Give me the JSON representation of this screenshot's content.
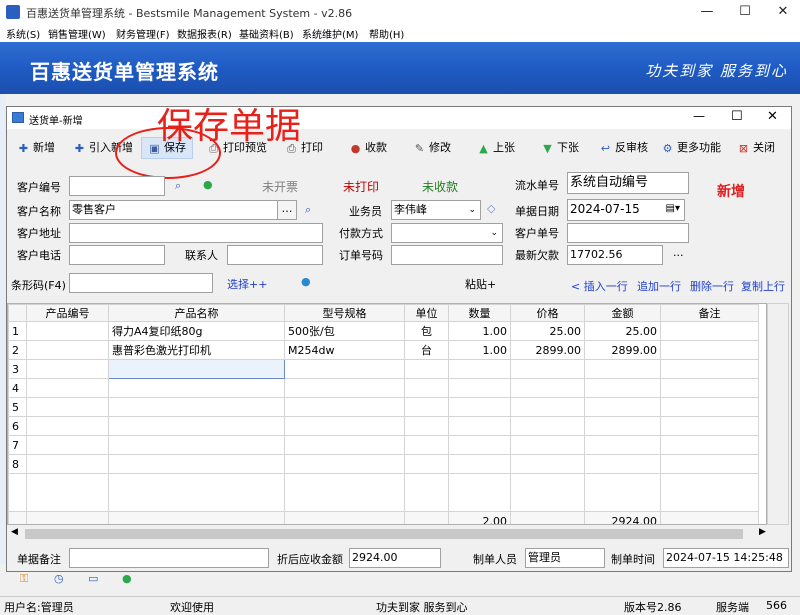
{
  "app": {
    "title": "百惠送货单管理系统 - Bestsmile Management System - v2.86",
    "menu": [
      "系统(S)",
      "销售管理(W)",
      "财务管理(F)",
      "数据报表(R)",
      "基础资料(B)",
      "系统维护(M)",
      "帮助(H)"
    ],
    "banner_title": "百惠送货单管理系统",
    "banner_slogan": "功夫到家  服务到心"
  },
  "window": {
    "title": "送货单-新增",
    "annotation": "保存单据"
  },
  "toolbar": {
    "new": "新增",
    "import_new": "引入新增",
    "save": "保存",
    "print_preview": "打印预览",
    "print": "打印",
    "receive": "收款",
    "edit": "修改",
    "prev": "上张",
    "next": "下张",
    "unaudit": "反审核",
    "more": "更多功能",
    "close": "关闭"
  },
  "form": {
    "customer_code_label": "客户编号",
    "customer_code": "",
    "customer_name_label": "客户名称",
    "customer_name": "零售客户",
    "customer_addr_label": "客户地址",
    "customer_addr": "",
    "customer_phone_label": "客户电话",
    "customer_phone": "",
    "contact_label": "联系人",
    "contact": "",
    "status_invoice": "未开票",
    "status_print": "未打印",
    "status_payment": "未收款",
    "salesman_label": "业务员",
    "salesman": "李伟峰",
    "payment_method_label": "付款方式",
    "payment_method": "",
    "order_no_label": "订单号码",
    "order_no": "",
    "serial_label": "流水单号",
    "serial": "系统自动编号",
    "date_label": "单据日期",
    "date": "2024-07-15",
    "cust_doc_label": "客户单号",
    "cust_doc": "",
    "debt_label": "最新欠款",
    "debt": "17702.56",
    "ellipsis": "...",
    "mode": "新增"
  },
  "barcode": {
    "label": "条形码(F4)",
    "value": "",
    "select": "选择++",
    "paste": "粘贴+",
    "insert_row": "< 插入一行",
    "append_row": "追加一行",
    "delete_row": "删除一行",
    "copy_row": "复制上行"
  },
  "grid": {
    "columns": [
      "",
      "产品编号",
      "产品名称",
      "型号规格",
      "单位",
      "数量",
      "价格",
      "金额",
      "备注"
    ],
    "rows": [
      [
        "1",
        "",
        "得力A4复印纸80g",
        "500张/包",
        "包",
        "1.00",
        "25.00",
        "25.00",
        ""
      ],
      [
        "2",
        "",
        "惠普彩色激光打印机",
        "M254dw",
        "台",
        "1.00",
        "2899.00",
        "2899.00",
        ""
      ],
      [
        "3",
        "",
        "",
        "",
        "",
        "",
        "",
        "",
        ""
      ],
      [
        "4",
        "",
        "",
        "",
        "",
        "",
        "",
        "",
        ""
      ],
      [
        "5",
        "",
        "",
        "",
        "",
        "",
        "",
        "",
        ""
      ],
      [
        "6",
        "",
        "",
        "",
        "",
        "",
        "",
        "",
        ""
      ],
      [
        "7",
        "",
        "",
        "",
        "",
        "",
        "",
        "",
        ""
      ],
      [
        "8",
        "",
        "",
        "",
        "",
        "",
        "",
        "",
        ""
      ]
    ],
    "total_qty": "2.00",
    "total_amount": "2924.00"
  },
  "footer": {
    "remark_label": "单据备注",
    "remark": "",
    "discount_label": "折后应收金额",
    "discount": "2924.00",
    "maker_label": "制单人员",
    "maker": "管理员",
    "time_label": "制单时间",
    "time": "2024-07-15 14:25:48"
  },
  "status": {
    "user": "用户名:管理员",
    "welcome": "欢迎使用",
    "slogan": "功夫到家 服务到心",
    "version": "版本号2.86",
    "client": "服务端",
    "count": "566"
  }
}
